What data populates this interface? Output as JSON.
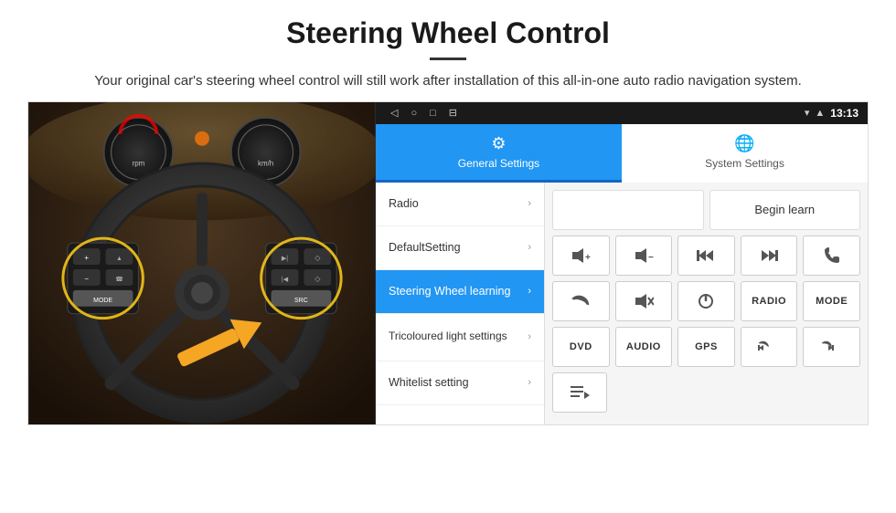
{
  "header": {
    "title": "Steering Wheel Control",
    "subtitle": "Your original car's steering wheel control will still work after installation of this all-in-one auto radio navigation system."
  },
  "status_bar": {
    "time": "13:13",
    "icons": [
      "◁",
      "○",
      "□",
      "⊟"
    ]
  },
  "tabs": [
    {
      "id": "general",
      "label": "General Settings",
      "icon": "⚙",
      "active": true
    },
    {
      "id": "system",
      "label": "System Settings",
      "icon": "🌐",
      "active": false
    }
  ],
  "menu_items": [
    {
      "id": "radio",
      "label": "Radio",
      "active": false
    },
    {
      "id": "default",
      "label": "DefaultSetting",
      "active": false
    },
    {
      "id": "steering",
      "label": "Steering Wheel learning",
      "active": true
    },
    {
      "id": "tricoloured",
      "label": "Tricoloured light settings",
      "active": false
    },
    {
      "id": "whitelist",
      "label": "Whitelist setting",
      "active": false
    }
  ],
  "begin_learn_label": "Begin learn",
  "button_rows": [
    [
      {
        "id": "vol-up",
        "label": "🔊+",
        "dark": false
      },
      {
        "id": "vol-down",
        "label": "🔊−",
        "dark": false
      },
      {
        "id": "prev-track",
        "label": "⏮",
        "dark": false
      },
      {
        "id": "next-track",
        "label": "⏭",
        "dark": false
      },
      {
        "id": "phone",
        "label": "📞",
        "dark": false
      }
    ],
    [
      {
        "id": "hang-up",
        "label": "↩",
        "dark": false
      },
      {
        "id": "mute",
        "label": "🔇",
        "dark": false
      },
      {
        "id": "power",
        "label": "⏻",
        "dark": false
      },
      {
        "id": "radio-btn",
        "label": "RADIO",
        "dark": false,
        "small": true
      },
      {
        "id": "mode-btn",
        "label": "MODE",
        "dark": false,
        "small": true
      }
    ],
    [
      {
        "id": "dvd-btn",
        "label": "DVD",
        "dark": false,
        "small": true
      },
      {
        "id": "audio-btn",
        "label": "AUDIO",
        "dark": false,
        "small": true
      },
      {
        "id": "gps-btn",
        "label": "GPS",
        "dark": false,
        "small": true
      },
      {
        "id": "tel-prev",
        "label": "📞⏮",
        "dark": false
      },
      {
        "id": "tel-next",
        "label": "📞⏭",
        "dark": false
      }
    ],
    [
      {
        "id": "playlist",
        "label": "☰",
        "dark": false
      }
    ]
  ]
}
